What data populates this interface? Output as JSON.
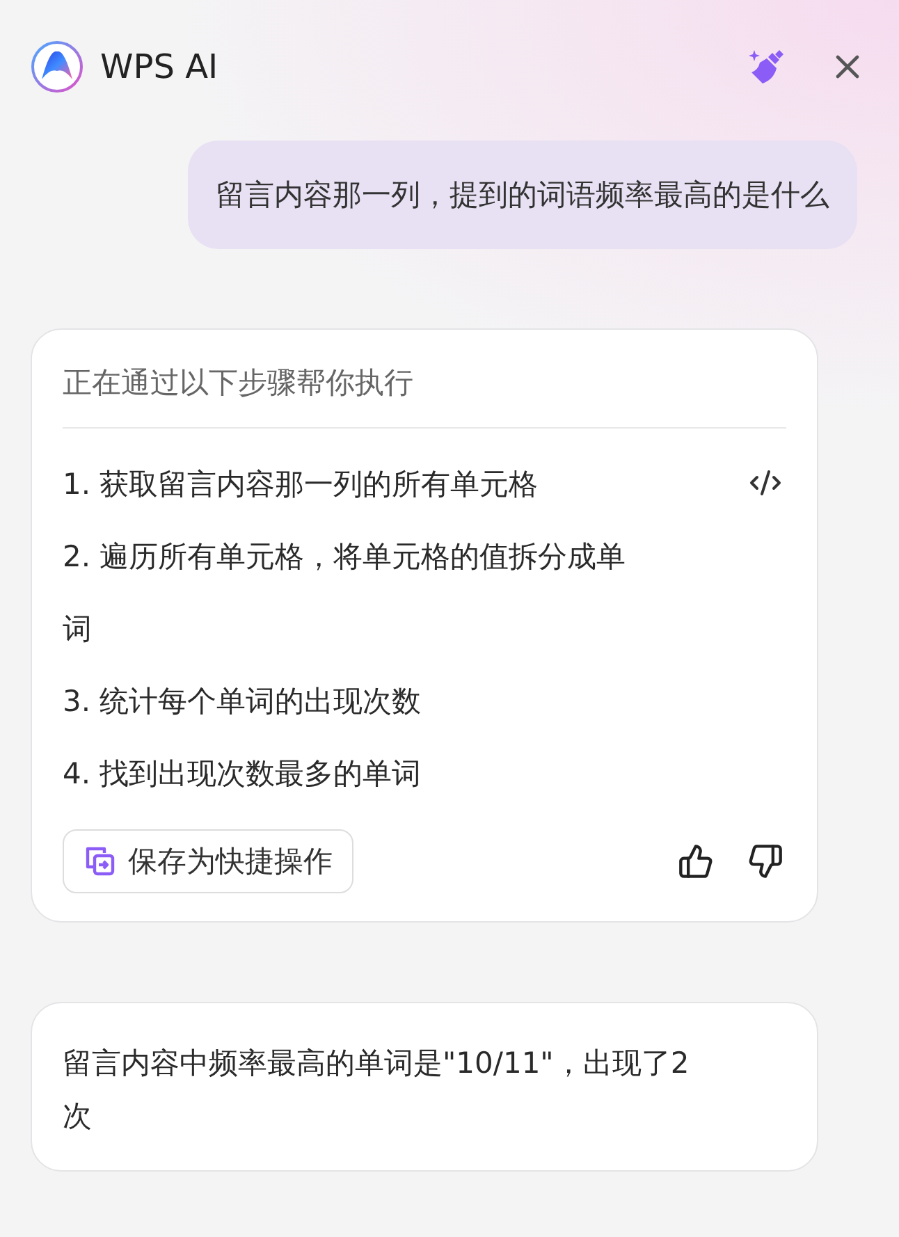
{
  "header": {
    "title": "WPS AI"
  },
  "user_message": "留言内容那一列，提到的词语频率最高的是什么",
  "plan_card": {
    "heading": "正在通过以下步骤帮你执行",
    "steps": [
      "1. 获取留言内容那一列的所有单元格",
      "2. 遍历所有单元格，将单元格的值拆分成单词",
      "3. 统计每个单词的出现次数",
      "4. 找到出现次数最多的单词"
    ],
    "save_button": "保存为快捷操作"
  },
  "answer": "留言内容中频率最高的单词是\"10/11\"，出现了2次"
}
